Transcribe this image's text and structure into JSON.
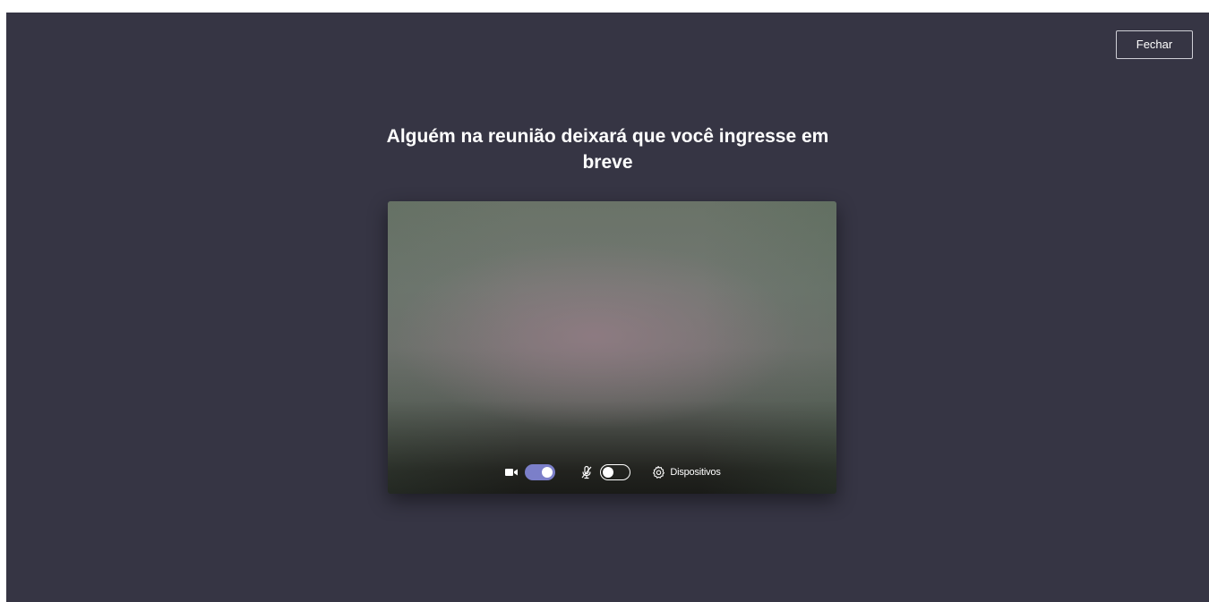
{
  "window": {
    "close_label": "Fechar"
  },
  "lobby": {
    "message": "Alguém na reunião deixará que você ingresse em breve"
  },
  "preview_controls": {
    "camera": {
      "icon": "video-camera-icon",
      "enabled": true
    },
    "microphone": {
      "icon": "microphone-off-icon",
      "enabled": false
    },
    "devices": {
      "icon": "gear-icon",
      "label": "Dispositivos"
    }
  },
  "colors": {
    "background": "#363544",
    "toggle_on": "#7b7fc9",
    "text": "#ffffff"
  }
}
